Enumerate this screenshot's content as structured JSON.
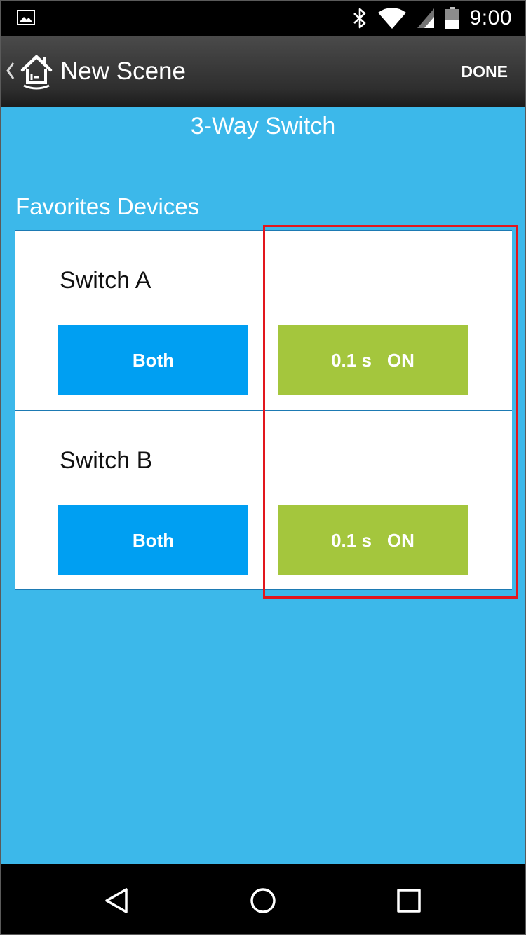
{
  "status_bar": {
    "time": "9:00",
    "icons": [
      "image-notification-icon",
      "bluetooth-icon",
      "wifi-icon",
      "signal-icon",
      "battery-icon"
    ]
  },
  "app_bar": {
    "title": "New Scene",
    "done_label": "DONE"
  },
  "device_title": "3-Way Switch",
  "section_title": "Favorites Devices",
  "devices": [
    {
      "name": "Switch A",
      "mode_label": "Both",
      "timer_value": "0.1 s",
      "state_label": "ON"
    },
    {
      "name": "Switch B",
      "mode_label": "Both",
      "timer_value": "0.1 s",
      "state_label": "ON"
    }
  ],
  "colors": {
    "background": "#3cb8ea",
    "mode_button": "#009ff2",
    "timer_button": "#a4c63d",
    "divider": "#1d7ab3",
    "highlight": "#e2161d"
  },
  "nav_bar": {
    "icons": [
      "back-triangle-icon",
      "home-circle-icon",
      "recents-square-icon"
    ]
  }
}
